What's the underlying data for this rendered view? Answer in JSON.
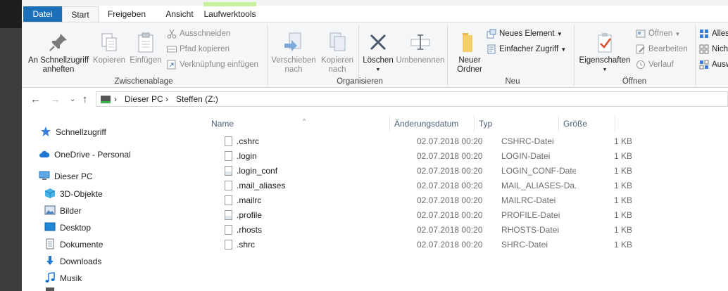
{
  "tabs": [
    "Datei",
    "Start",
    "Freigeben",
    "Ansicht",
    "Laufwerktools"
  ],
  "ribbon": {
    "zwischenablage": {
      "label": "Zwischenablage",
      "pin": "An Schnellzugriff anheften",
      "copy": "Kopieren",
      "paste": "Einfügen",
      "cut": "Ausschneiden",
      "copy_path": "Pfad kopieren",
      "paste_link": "Verknüpfung einfügen"
    },
    "organisieren": {
      "label": "Organisieren",
      "move": "Verschieben nach",
      "copy_to": "Kopieren nach",
      "delete": "Löschen",
      "rename": "Umbenennen"
    },
    "neu": {
      "label": "Neu",
      "new_folder": "Neuer Ordner",
      "new_item": "Neues Element",
      "easy_access": "Einfacher Zugriff"
    },
    "oeffnen": {
      "label": "Öffnen",
      "properties": "Eigenschaften",
      "open": "Öffnen",
      "edit": "Bearbeiten",
      "history": "Verlauf"
    },
    "auswaehlen": {
      "all": "Alles",
      "none": "Nich",
      "invert": "Ausw"
    }
  },
  "address": {
    "crumbs": [
      "Dieser PC",
      "Steffen (Z:)"
    ]
  },
  "nav": {
    "quick": "Schnellzugriff",
    "onedrive": "OneDrive - Personal",
    "thispc": "Dieser PC",
    "items": [
      "3D-Objekte",
      "Bilder",
      "Desktop",
      "Dokumente",
      "Downloads",
      "Musik"
    ]
  },
  "columns": {
    "name": "Name",
    "date": "Änderungsdatum",
    "type": "Typ",
    "size": "Größe"
  },
  "files": [
    {
      "name": ".cshrc",
      "date": "02.07.2018 00:20",
      "type": "CSHRC-Datei",
      "size": "1 KB"
    },
    {
      "name": ".login",
      "date": "02.07.2018 00:20",
      "type": "LOGIN-Datei",
      "size": "1 KB"
    },
    {
      "name": ".login_conf",
      "date": "02.07.2018 00:20",
      "type": "LOGIN_CONF-Datei",
      "size": "1 KB"
    },
    {
      "name": ".mail_aliases",
      "date": "02.07.2018 00:20",
      "type": "MAIL_ALIASES-Da...",
      "size": "1 KB"
    },
    {
      "name": ".mailrc",
      "date": "02.07.2018 00:20",
      "type": "MAILRC-Datei",
      "size": "1 KB"
    },
    {
      "name": ".profile",
      "date": "02.07.2018 00:20",
      "type": "PROFILE-Datei",
      "size": "1 KB"
    },
    {
      "name": ".rhosts",
      "date": "02.07.2018 00:20",
      "type": "RHOSTS-Datei",
      "size": "1 KB"
    },
    {
      "name": ".shrc",
      "date": "02.07.2018 00:20",
      "type": "SHRC-Datei",
      "size": "1 KB"
    }
  ]
}
